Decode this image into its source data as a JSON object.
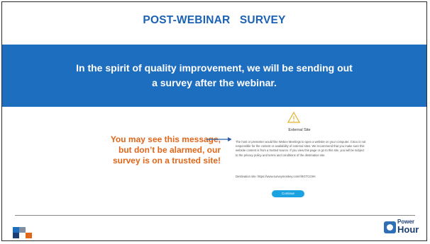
{
  "slide": {
    "title": "POST-WEBINAR   SURVEY",
    "banner_text": "In the spirit of quality improvement, we will be sending out a survey after the webinar.",
    "callout_lines": [
      "You may see this message,",
      "but don’t be alarmed, our",
      "survey is on a trusted site!"
    ]
  },
  "dialog": {
    "title": "External Site",
    "body": "The host or presenter would like Webex Meetings to open a website on your computer. Cisco is not responsible for the content or availability of external sites. We recommend that you make sure this website content is from a trusted source. If you view this page or go to this site, you will be subject to the privacy policy and terms and conditions of the destination site.",
    "destination": "Destination site:  https://www.surveymonkey.com/r/8GTCC9H",
    "button": "Continue",
    "icon": "warning-icon"
  },
  "footer": {
    "logo_text_top": "Power",
    "logo_text_bottom": "Hour"
  },
  "colors": {
    "title_blue": "#1b62b5",
    "band_blue": "#1e6ec0",
    "callout_orange": "#e0661a",
    "button_blue": "#1aa3e0"
  }
}
